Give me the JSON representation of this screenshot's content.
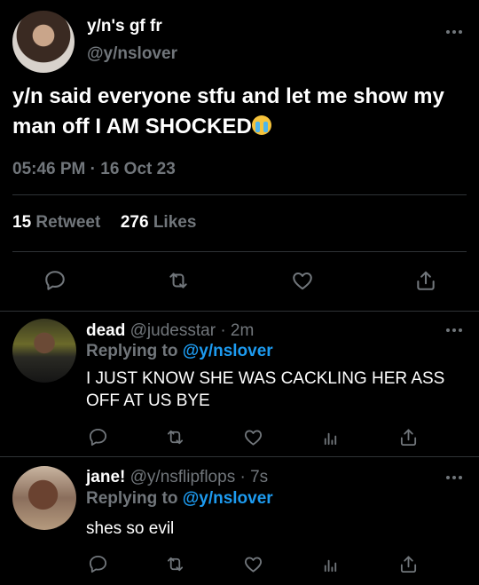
{
  "main_tweet": {
    "display_name": "y/n's gf fr",
    "handle": "@y/nslover",
    "text": "y/n said everyone stfu and let me show my man off I AM SHOCKED",
    "emoji": "loudly-crying-face",
    "timestamp": "05:46 PM · 16 Oct 23",
    "retweets_count": "15",
    "retweets_label": "Retweet",
    "likes_count": "276",
    "likes_label": "Likes",
    "actions": [
      "reply-icon",
      "retweet-icon",
      "like-icon",
      "share-icon"
    ]
  },
  "replies": [
    {
      "display_name": "dead",
      "handle": "@judesstar",
      "time": "· 2m",
      "replying_label": "Replying to",
      "replying_to": "@y/nslover",
      "text": "I JUST KNOW SHE WAS CACKLING HER ASS OFF AT US BYE"
    },
    {
      "display_name": "jane!",
      "handle": "@y/nsflipflops",
      "time": "· 7s",
      "replying_label": "Replying to",
      "replying_to": "@y/nslover",
      "text": "shes so evil"
    }
  ],
  "colors": {
    "background": "#000000",
    "text": "#e7e9ea",
    "secondary": "#71767b",
    "link": "#1d9bf0",
    "divider": "#2f3336"
  }
}
